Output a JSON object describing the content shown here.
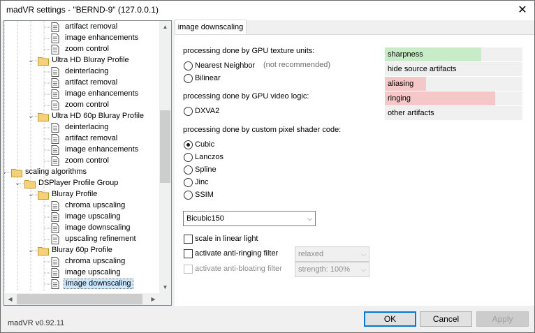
{
  "window": {
    "title": "madVR settings - \"BERND-9\" (127.0.0.1)",
    "close_glyph": "✕"
  },
  "tree": {
    "nodes": [
      {
        "label": "artifact removal",
        "icon": "page-icon"
      },
      {
        "label": "image enhancements",
        "icon": "page-icon"
      },
      {
        "label": "zoom control",
        "icon": "page-icon"
      },
      {
        "label": "Ultra HD Bluray Profile",
        "icon": "folder-icon"
      },
      {
        "label": "deinterlacing",
        "icon": "page-icon"
      },
      {
        "label": "artifact removal",
        "icon": "page-icon"
      },
      {
        "label": "image enhancements",
        "icon": "page-icon"
      },
      {
        "label": "zoom control",
        "icon": "page-icon"
      },
      {
        "label": "Ultra HD 60p Bluray Profile",
        "icon": "folder-icon"
      },
      {
        "label": "deinterlacing",
        "icon": "page-icon"
      },
      {
        "label": "artifact removal",
        "icon": "page-icon"
      },
      {
        "label": "image enhancements",
        "icon": "page-icon"
      },
      {
        "label": "zoom control",
        "icon": "page-icon"
      },
      {
        "label": "scaling algorithms",
        "icon": "folder-icon"
      },
      {
        "label": "DSPlayer Profile Group",
        "icon": "folder-icon"
      },
      {
        "label": "Bluray Profile",
        "icon": "folder-icon"
      },
      {
        "label": "chroma upscaling",
        "icon": "page-icon"
      },
      {
        "label": "image upscaling",
        "icon": "page-icon"
      },
      {
        "label": "image downscaling",
        "icon": "page-icon"
      },
      {
        "label": "upscaling refinement",
        "icon": "page-icon"
      },
      {
        "label": "Bluray 60p Profile",
        "icon": "folder-icon"
      },
      {
        "label": "chroma upscaling",
        "icon": "page-icon"
      },
      {
        "label": "image upscaling",
        "icon": "page-icon"
      },
      {
        "label": "image downscaling",
        "icon": "page-icon",
        "selected": true
      }
    ],
    "scroll_glyphs": {
      "up": "▲",
      "down": "▼",
      "left": "◀",
      "right": "▶"
    }
  },
  "tab": {
    "label": "image downscaling"
  },
  "page": {
    "section_gpu_texture": "processing done by GPU texture units:",
    "nearest": "Nearest Neighbor",
    "not_recommended": "(not recommended)",
    "bilinear": "Bilinear",
    "section_video_logic": "processing done by GPU video logic:",
    "dxva2": "DXVA2",
    "section_shader": "processing done by custom pixel shader code:",
    "cubic": "Cubic",
    "lanczos": "Lanczos",
    "spline": "Spline",
    "jinc": "Jinc",
    "ssim": "SSIM",
    "selected_radio": "Cubic",
    "algo_select": "Bicubic150",
    "scale_linear_light": "scale in linear light",
    "anti_ringing": "activate anti-ringing filter",
    "anti_ringing_value": "relaxed",
    "anti_bloating": "activate anti-bloating filter",
    "anti_bloating_value": "strength: 100%",
    "select_arrow": "⌵"
  },
  "quality": [
    {
      "label": "sharpness",
      "level": 0.7,
      "color": "#c8ecc8"
    },
    {
      "label": "hide source artifacts",
      "level": 0,
      "color": "#f0f0f0"
    },
    {
      "label": "aliasing",
      "level": 0.3,
      "color": "#f4c8c8"
    },
    {
      "label": "ringing",
      "level": 0.8,
      "color": "#f4c8c8"
    },
    {
      "label": "other artifacts",
      "level": 0,
      "color": "#f0f0f0"
    }
  ],
  "footer": {
    "version": "madVR v0.92.11",
    "ok": "OK",
    "cancel": "Cancel",
    "apply": "Apply"
  }
}
